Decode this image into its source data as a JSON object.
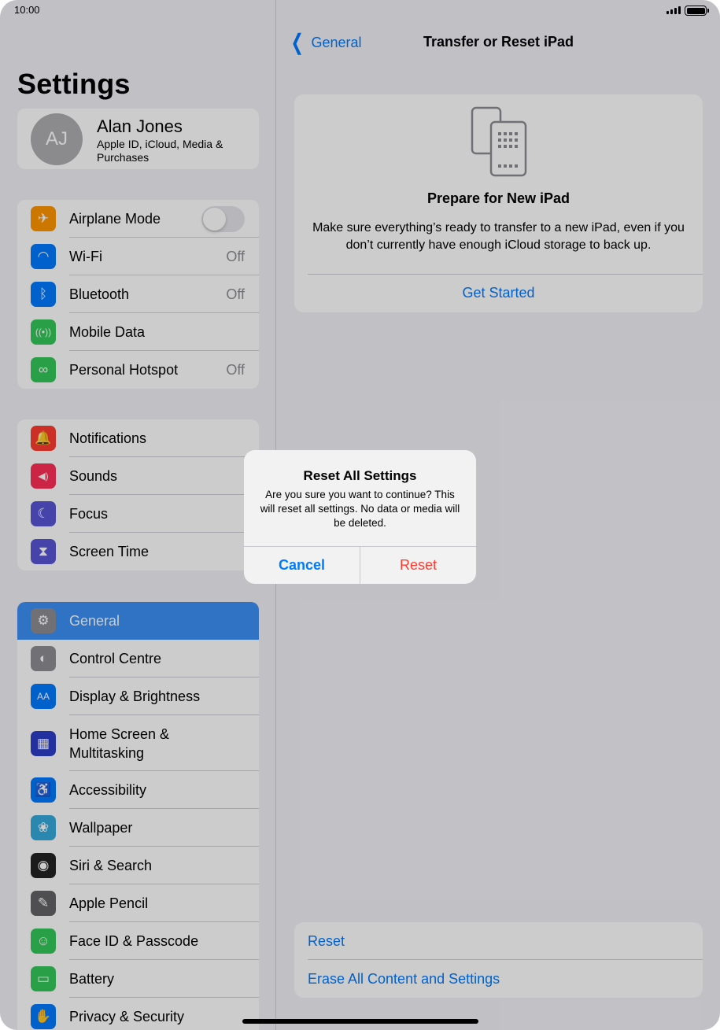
{
  "status_bar": {
    "time": "10:00"
  },
  "sidebar": {
    "title": "Settings",
    "profile": {
      "initials": "AJ",
      "name": "Alan Jones",
      "subtitle": "Apple ID, iCloud, Media & Purchases"
    },
    "group1": [
      {
        "label": "Airplane Mode",
        "icon": "airplane-icon",
        "color": "#ff9500",
        "toggle": false
      },
      {
        "label": "Wi-Fi",
        "icon": "wifi-icon",
        "color": "#007aff",
        "value": "Off"
      },
      {
        "label": "Bluetooth",
        "icon": "bluetooth-icon",
        "color": "#007aff",
        "value": "Off"
      },
      {
        "label": "Mobile Data",
        "icon": "antenna-icon",
        "color": "#34c759"
      },
      {
        "label": "Personal Hotspot",
        "icon": "hotspot-icon",
        "color": "#34c759",
        "value": "Off"
      }
    ],
    "group2": [
      {
        "label": "Notifications",
        "icon": "bell-icon",
        "color": "#ff3b30"
      },
      {
        "label": "Sounds",
        "icon": "speaker-icon",
        "color": "#ff2d55"
      },
      {
        "label": "Focus",
        "icon": "moon-icon",
        "color": "#5856d6"
      },
      {
        "label": "Screen Time",
        "icon": "hourglass-icon",
        "color": "#5856d6"
      }
    ],
    "group3": [
      {
        "label": "General",
        "icon": "gear-icon",
        "color": "#8e8e93",
        "selected": true
      },
      {
        "label": "Control Centre",
        "icon": "switches-icon",
        "color": "#8e8e93"
      },
      {
        "label": "Display & Brightness",
        "icon": "text-size-icon",
        "color": "#007aff"
      },
      {
        "label": "Home Screen &\nMultitasking",
        "icon": "app-grid-icon",
        "color": "#2c3ec9"
      },
      {
        "label": "Accessibility",
        "icon": "accessibility-icon",
        "color": "#007aff"
      },
      {
        "label": "Wallpaper",
        "icon": "flower-icon",
        "color": "#35aadc"
      },
      {
        "label": "Siri & Search",
        "icon": "siri-icon",
        "color": "#222222"
      },
      {
        "label": "Apple Pencil",
        "icon": "pencil-icon",
        "color": "#636366"
      },
      {
        "label": "Face ID & Passcode",
        "icon": "face-id-icon",
        "color": "#34c759"
      },
      {
        "label": "Battery",
        "icon": "battery-icon",
        "color": "#34c759"
      },
      {
        "label": "Privacy & Security",
        "icon": "hand-icon",
        "color": "#007aff"
      }
    ]
  },
  "detail": {
    "back_label": "General",
    "title": "Transfer or Reset iPad",
    "card": {
      "title": "Prepare for New iPad",
      "description": "Make sure everything’s ready to transfer to a new iPad, even if you don’t currently have enough iCloud storage to back up.",
      "button": "Get Started"
    },
    "bottom": {
      "reset": "Reset",
      "erase": "Erase All Content and Settings"
    }
  },
  "alert": {
    "title": "Reset All Settings",
    "message": "Are you sure you want to continue? This will reset all settings. No data or media will be deleted.",
    "cancel": "Cancel",
    "confirm": "Reset"
  },
  "colors": {
    "accent": "#007aff",
    "destructive": "#ff3b30",
    "selected_row": "#3d8ff6"
  }
}
